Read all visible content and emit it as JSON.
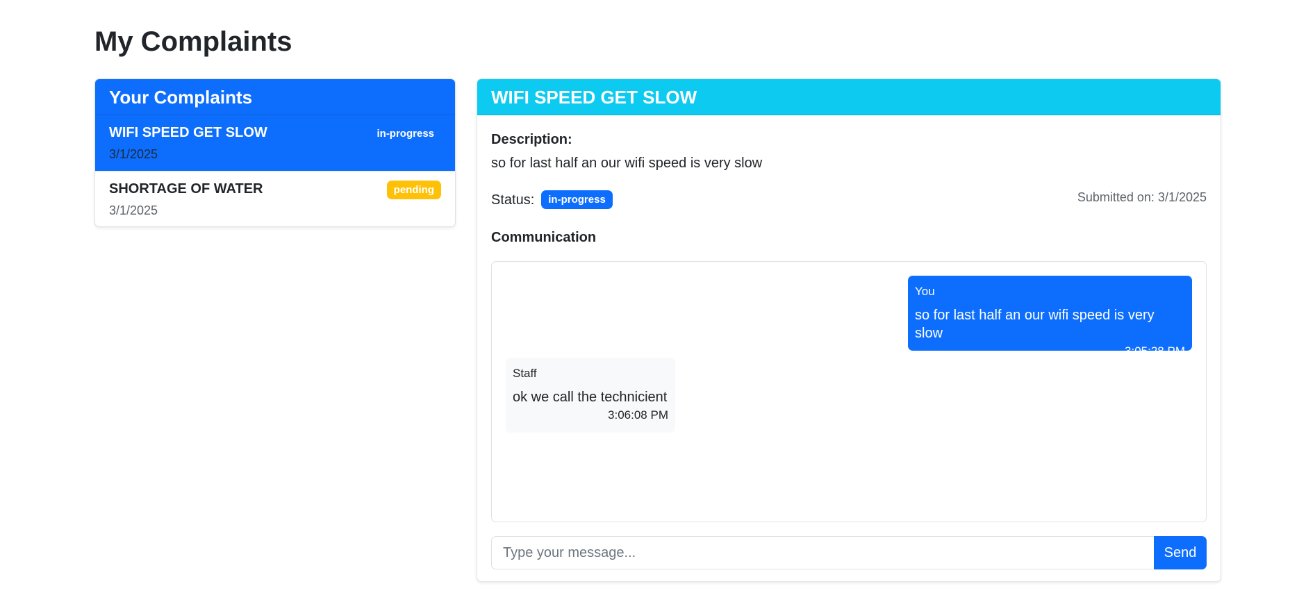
{
  "page": {
    "title": "My Complaints"
  },
  "list": {
    "header": "Your Complaints",
    "items": [
      {
        "title": "WIFI SPEED GET SLOW",
        "date": "3/1/2025",
        "status": "in-progress",
        "active": true
      },
      {
        "title": "SHORTAGE OF WATER",
        "date": "3/1/2025",
        "status": "pending",
        "active": false
      }
    ]
  },
  "detail": {
    "title": "WIFI SPEED GET SLOW",
    "description_label": "Description:",
    "description": "so for last half an our wifi speed is very slow",
    "status_label": "Status:",
    "status": "in-progress",
    "submitted": "Submitted on: 3/1/2025",
    "communication_label": "Communication",
    "messages": [
      {
        "sender": "You",
        "text": "so for last half an our wifi speed is very slow",
        "time": "3:05:28 PM"
      },
      {
        "sender": "Staff",
        "text": "ok we call the technicient",
        "time": "3:06:08 PM"
      }
    ],
    "input_placeholder": "Type your message...",
    "input_value": "",
    "send_label": "Send"
  },
  "colors": {
    "primary": "#0d6efd",
    "info": "#0dcaf0",
    "warning": "#ffc107",
    "staff_bubble": "#f8f9fa"
  }
}
